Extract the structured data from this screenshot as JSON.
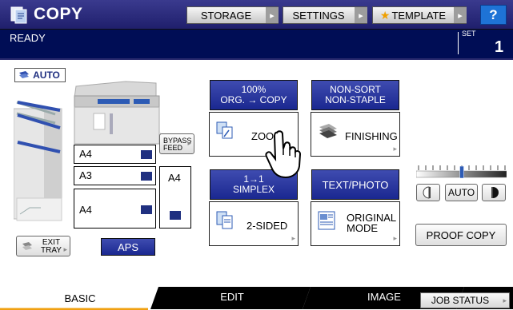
{
  "title": {
    "app_name": "COPY",
    "icon": "copy-icon"
  },
  "top_buttons": {
    "storage": "STORAGE",
    "settings": "SETTINGS",
    "template": "TEMPLATE",
    "help": "?"
  },
  "status": {
    "text": "READY",
    "set_label": "SET",
    "set_count": "1"
  },
  "paper": {
    "auto_label": "AUTO",
    "trays": [
      {
        "label": "A4"
      },
      {
        "label": "A3"
      },
      {
        "label": "A4"
      }
    ],
    "bypass_label": "BYPASS\nFEED",
    "bypass_size": "A4",
    "exit_tray": "EXIT\nTRAY",
    "aps": "APS"
  },
  "functions": {
    "zoom": {
      "header": "100%\nORG. → COPY",
      "label": "ZOOM"
    },
    "finishing": {
      "header": "NON-SORT\nNON-STAPLE",
      "label": "FINISHING"
    },
    "duplex": {
      "header": "1→1\nSIMPLEX",
      "label": "2-SIDED"
    },
    "original_mode": {
      "header": "TEXT/PHOTO",
      "label": "ORIGINAL\nMODE"
    }
  },
  "density": {
    "auto_label": "AUTO",
    "level": 0.5
  },
  "proof_copy": "PROOF COPY",
  "tabs": {
    "basic": "BASIC",
    "edit": "EDIT",
    "image": "IMAGE"
  },
  "job_status": "JOB STATUS",
  "colors": {
    "header_blue": "#1a2890",
    "title_bar": "#1f1f6c",
    "status_bar": "#000d55",
    "help_blue": "#1e73d6",
    "tab_orange": "#f0a010"
  }
}
